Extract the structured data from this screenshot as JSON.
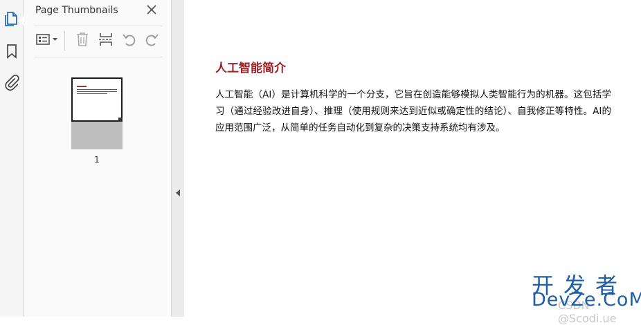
{
  "rail": {
    "items": [
      {
        "name": "page-thumbnails",
        "icon": "pages-icon",
        "active": true
      },
      {
        "name": "bookmarks",
        "icon": "bookmark-icon",
        "active": false
      },
      {
        "name": "attachments",
        "icon": "paperclip-icon",
        "active": false
      }
    ]
  },
  "panel": {
    "title": "Page Thumbnails",
    "close_icon": "close-icon",
    "toolbar": [
      "options-menu-icon",
      "delete-page-icon",
      "insert-page-icon",
      "rotate-left-icon",
      "rotate-right-icon"
    ],
    "thumbnails": [
      {
        "page_number": "1"
      }
    ]
  },
  "document": {
    "title": "人工智能简介",
    "body": "人工智能（AI）是计算机科学的一个分支，它旨在创造能够模拟人类智能行为的机器。这包括学习（通过经验改进自身）、推理（使用规则来达到近似或确定性的结论）、自我修正等特性。AI的应用范围广泛，从简单的任务自动化到复杂的决策支持系统均有涉及。"
  },
  "watermark": {
    "cn": "开发者",
    "en": "DevZe.CoM",
    "faint": "CSDN @Scodi.ue"
  },
  "colors": {
    "accent": "#2d6fb5",
    "title_red": "#9b2226",
    "watermark_blue": "#1f5fa8"
  }
}
